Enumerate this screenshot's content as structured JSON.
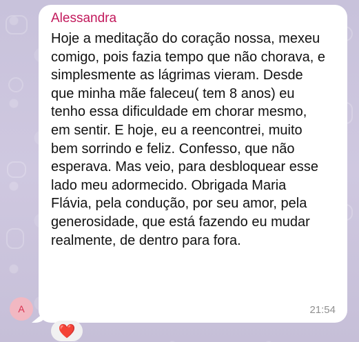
{
  "chat": {
    "avatar_initial": "A",
    "sender_name": "Alessandra",
    "message_text": "Hoje a meditação do coração nossa, mexeu comigo, pois fazia tempo que não chorava, e simplesmente as lágrimas vieram. Desde que minha mãe faleceu( tem 8 anos) eu tenho essa dificuldade em chorar mesmo, em sentir. E hoje, eu a reencontrei, muito bem sorrindo e feliz. Confesso, que não esperava. Mas veio, para desbloquear esse lado meu adormecido. Obrigada Maria Flávia, pela condução, por seu amor, pela generosidade, que está fazendo eu mudar realmente, de dentro para fora.",
    "timestamp": "21:54",
    "reaction": "❤️"
  },
  "colors": {
    "sender_name": "#c2185b",
    "avatar_bg": "#f2b8c2",
    "avatar_text": "#d9304f",
    "background": "#c9c3dc"
  },
  "icons": {
    "reaction": "heart-icon"
  }
}
